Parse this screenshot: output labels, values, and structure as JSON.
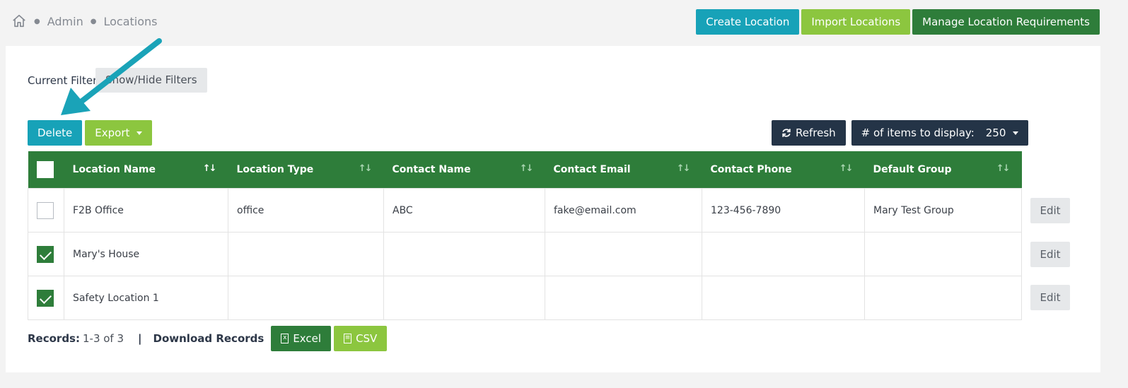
{
  "breadcrumb": {
    "home_icon": "home-icon",
    "items": [
      "Admin",
      "Locations"
    ]
  },
  "top_actions": {
    "create": "Create Location",
    "import": "Import Locations",
    "manage": "Manage Location Requirements"
  },
  "filters": {
    "label": "Current Filters",
    "toggle": "Show/Hide Filters"
  },
  "actions": {
    "delete": "Delete",
    "export": "Export"
  },
  "toolbar": {
    "refresh": "Refresh",
    "items_label": "# of items to display:",
    "items_value": "250"
  },
  "table": {
    "columns": [
      "Location Name",
      "Location Type",
      "Contact Name",
      "Contact Email",
      "Contact Phone",
      "Default Group"
    ],
    "rows": [
      {
        "checked": false,
        "cells": [
          "F2B Office",
          "office",
          "ABC",
          "fake@email.com",
          "123-456-7890",
          "Mary Test Group"
        ],
        "edit": "Edit"
      },
      {
        "checked": true,
        "cells": [
          "Mary's House",
          "",
          "",
          "",
          "",
          ""
        ],
        "edit": "Edit"
      },
      {
        "checked": true,
        "cells": [
          "Safety Location 1",
          "",
          "",
          "",
          "",
          ""
        ],
        "edit": "Edit"
      }
    ]
  },
  "footer": {
    "records_label": "Records:",
    "records_value": "1-3 of 3",
    "pipe": "|",
    "download_label": "Download Records",
    "excel": "Excel",
    "csv": "CSV"
  },
  "colors": {
    "teal": "#17a2b8",
    "lime": "#8cc63f",
    "dark_green": "#2e7d3a",
    "navy": "#243447"
  }
}
